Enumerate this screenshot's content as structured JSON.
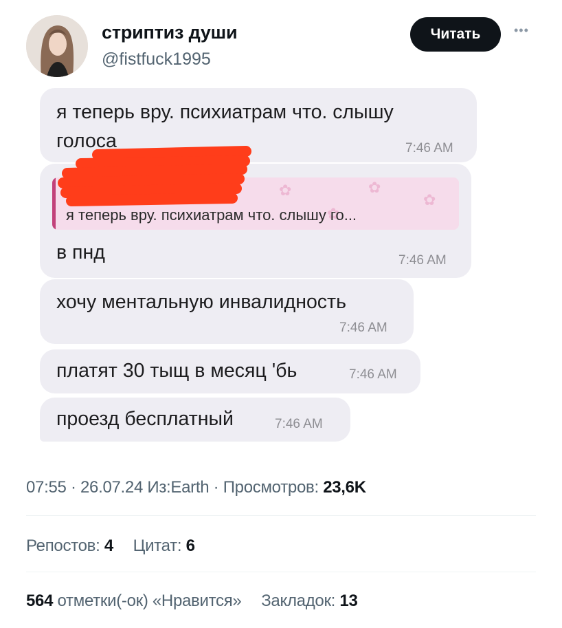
{
  "author": {
    "display_name": "стриптиз души",
    "handle": "@fistfuck1995"
  },
  "follow_label": "Читать",
  "more_icon": "more-horizontal-icon",
  "messages": [
    {
      "line1": "я теперь вру. психиатрам что. слышу",
      "line2": "голоса",
      "time": "7:46 AM"
    },
    {
      "quote": "я теперь вру. психиатрам что. слышу го...",
      "text": "в пнд",
      "time": "7:46 AM"
    },
    {
      "text": "хочу ментальную инвалидность",
      "time": "7:46 AM"
    },
    {
      "text": "платят 30 тыщ в месяц 'бь",
      "time": "7:46 AM"
    },
    {
      "text": "проезд бесплатный",
      "time": "7:46 AM"
    }
  ],
  "meta": {
    "time": "07:55",
    "date": "26.07.24",
    "source": "Из:Earth",
    "views_label": "Просмотров:",
    "views_value": "23,6K"
  },
  "stats": {
    "reposts_label": "Репостов:",
    "reposts_value": "4",
    "quotes_label": "Цитат:",
    "quotes_value": "6",
    "likes_value": "564",
    "likes_label": "отметки(-ок) «Нравится»",
    "bookmarks_label": "Закладок:",
    "bookmarks_value": "13"
  },
  "colors": {
    "bubble": "#eeedf3",
    "button": "#0f1419",
    "quote_accent": "#c2417a",
    "redaction": "#ff3d1a"
  }
}
